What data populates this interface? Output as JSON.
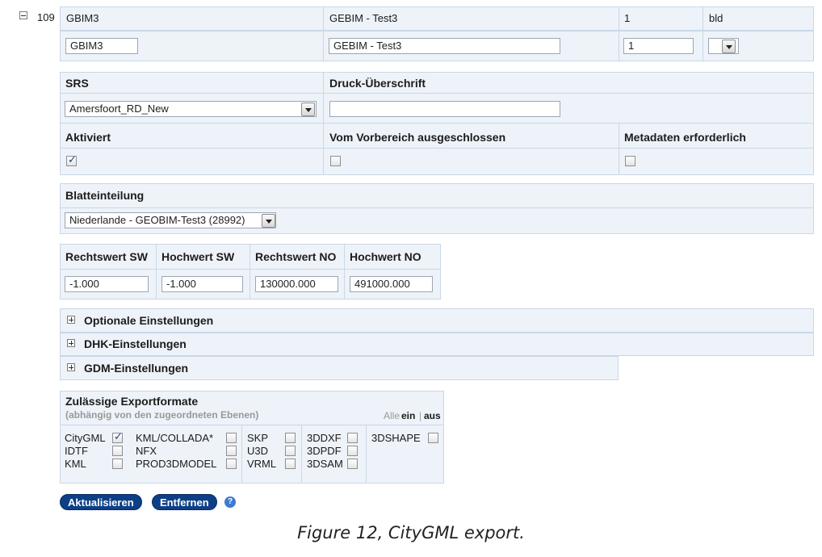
{
  "row": {
    "id": "109",
    "name": "GBIM3",
    "title": "GEBIM - Test3",
    "number": "1",
    "code": "bld",
    "name_value": "GBIM3",
    "title_value": "GEBIM - Test3",
    "number_value": "1",
    "code_value": ""
  },
  "srs_section": {
    "srs_label": "SRS",
    "srs_value": "Amersfoort_RD_New",
    "print_heading_label": "Druck-Überschrift",
    "print_heading_value": "",
    "activated_label": "Aktiviert",
    "activated_checked": true,
    "excluded_label": "Vom Vorbereich ausgeschlossen",
    "excluded_checked": false,
    "metadata_label": "Metadaten erforderlich",
    "metadata_checked": false
  },
  "sheet_section": {
    "label": "Blatteinteilung",
    "value": "Niederlande - GEOBIM-Test3 (28992)"
  },
  "coords": {
    "headers": [
      "Rechtswert SW",
      "Hochwert SW",
      "Rechtswert NO",
      "Hochwert NO"
    ],
    "values": [
      "-1.000",
      "-1.000",
      "130000.000",
      "491000.000"
    ]
  },
  "collapsibles": [
    {
      "label": "Optionale Einstellungen"
    },
    {
      "label": "DHK-Einstellungen"
    },
    {
      "label": "GDM-Einstellungen"
    }
  ],
  "formats": {
    "title": "Zulässige Exportformate",
    "subtitle": "(abhängig von den zugeordneten Ebenen)",
    "all_label": "Alle",
    "on_label": "ein",
    "separator": "|",
    "off_label": "aus",
    "items": [
      {
        "label": "CityGML",
        "checked": true
      },
      {
        "label": "IDTF",
        "checked": false
      },
      {
        "label": "KML",
        "checked": false
      },
      {
        "label": "KML/COLLADA*",
        "checked": false
      },
      {
        "label": "NFX",
        "checked": false
      },
      {
        "label": "PROD3DMODEL",
        "checked": false
      },
      {
        "label": "SKP",
        "checked": false
      },
      {
        "label": "U3D",
        "checked": false
      },
      {
        "label": "VRML",
        "checked": false
      },
      {
        "label": "3DDXF",
        "checked": false
      },
      {
        "label": "3DPDF",
        "checked": false
      },
      {
        "label": "3DSAM",
        "checked": false
      },
      {
        "label": "3DSHAPE",
        "checked": false
      }
    ]
  },
  "buttons": {
    "update": "Aktualisieren",
    "remove": "Entfernen",
    "help": "?"
  },
  "caption": "Figure 12, CityGML export.",
  "icons": {
    "collapse": "minus-box-icon",
    "expand": "plus-box-icon",
    "dropdown": "chevron-down-icon",
    "help": "help-icon"
  }
}
